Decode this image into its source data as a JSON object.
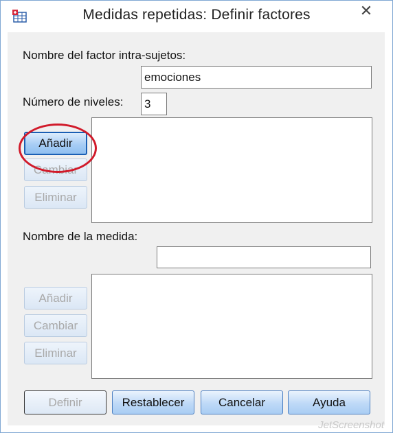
{
  "window": {
    "title": "Medidas repetidas: Definir factores",
    "close_glyph": "✕"
  },
  "factor": {
    "name_label": "Nombre del factor intra-sujetos:",
    "name_value": "emociones",
    "levels_label": "Número de niveles:",
    "levels_value": "3",
    "buttons": {
      "add": "Añadir",
      "change": "Cambiar",
      "remove": "Eliminar"
    }
  },
  "measure": {
    "name_label": "Nombre de la medida:",
    "name_value": "",
    "buttons": {
      "add": "Añadir",
      "change": "Cambiar",
      "remove": "Eliminar"
    }
  },
  "footer": {
    "define": "Definir",
    "reset": "Restablecer",
    "cancel": "Cancelar",
    "help": "Ayuda"
  },
  "watermark": "JetScreenshot",
  "icons": {
    "app": "spss-repeated-measures-icon",
    "close": "close-icon"
  },
  "colors": {
    "highlight": "#d11a2a",
    "button_border": "#4a7ec1",
    "button_fill": "#bed9f7"
  }
}
